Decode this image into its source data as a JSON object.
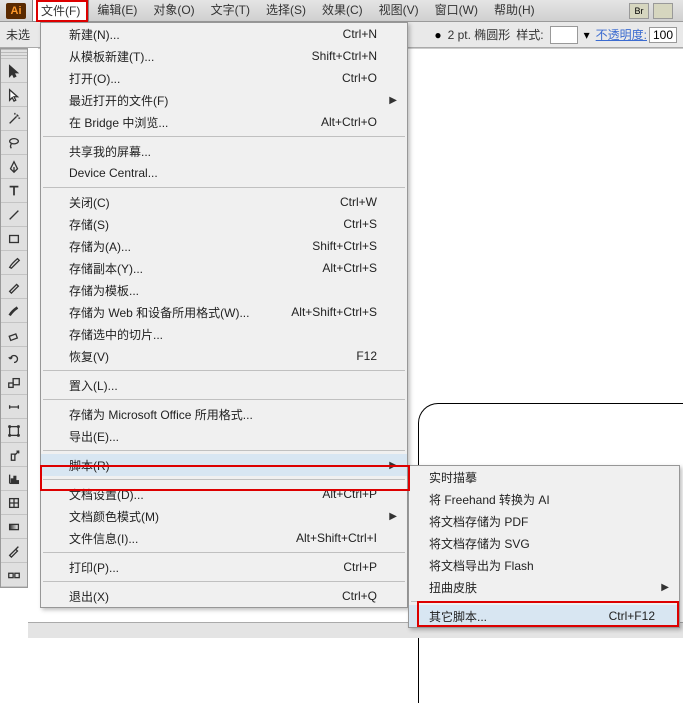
{
  "app": {
    "icon_text": "Ai"
  },
  "menubar": {
    "items": [
      "文件(F)",
      "编辑(E)",
      "对象(O)",
      "文字(T)",
      "选择(S)",
      "效果(C)",
      "视图(V)",
      "窗口(W)",
      "帮助(H)"
    ],
    "right_chips": [
      "Br",
      ""
    ]
  },
  "optbar": {
    "left_label": "未选",
    "stroke_label": "2 pt. 椭圆形",
    "style_label": "样式:",
    "opacity_label": "不透明度:",
    "opacity_value": "100"
  },
  "file_menu": [
    {
      "label": "新建(N)...",
      "shortcut": "Ctrl+N"
    },
    {
      "label": "从模板新建(T)...",
      "shortcut": "Shift+Ctrl+N"
    },
    {
      "label": "打开(O)...",
      "shortcut": "Ctrl+O"
    },
    {
      "label": "最近打开的文件(F)",
      "arrow": true
    },
    {
      "label": "在 Bridge 中浏览...",
      "shortcut": "Alt+Ctrl+O"
    },
    {
      "sep": true
    },
    {
      "label": "共享我的屏幕..."
    },
    {
      "label": "Device Central..."
    },
    {
      "sep": true
    },
    {
      "label": "关闭(C)",
      "shortcut": "Ctrl+W"
    },
    {
      "label": "存储(S)",
      "shortcut": "Ctrl+S"
    },
    {
      "label": "存储为(A)...",
      "shortcut": "Shift+Ctrl+S"
    },
    {
      "label": "存储副本(Y)...",
      "shortcut": "Alt+Ctrl+S"
    },
    {
      "label": "存储为模板..."
    },
    {
      "label": "存储为 Web 和设备所用格式(W)...",
      "shortcut": "Alt+Shift+Ctrl+S"
    },
    {
      "label": "存储选中的切片..."
    },
    {
      "label": "恢复(V)",
      "shortcut": "F12"
    },
    {
      "sep": true
    },
    {
      "label": "置入(L)..."
    },
    {
      "sep": true
    },
    {
      "label": "存储为 Microsoft Office 所用格式..."
    },
    {
      "label": "导出(E)..."
    },
    {
      "sep": true
    },
    {
      "label": "脚本(R)",
      "arrow": true,
      "hover": true
    },
    {
      "sep": true
    },
    {
      "label": "文档设置(D)...",
      "shortcut": "Alt+Ctrl+P"
    },
    {
      "label": "文档颜色模式(M)",
      "arrow": true
    },
    {
      "label": "文件信息(I)...",
      "shortcut": "Alt+Shift+Ctrl+I"
    },
    {
      "sep": true
    },
    {
      "label": "打印(P)...",
      "shortcut": "Ctrl+P"
    },
    {
      "sep": true
    },
    {
      "label": "退出(X)",
      "shortcut": "Ctrl+Q"
    }
  ],
  "script_submenu": [
    {
      "label": "实时描摹"
    },
    {
      "label": "将 Freehand 转换为 AI"
    },
    {
      "label": "将文档存储为 PDF"
    },
    {
      "label": "将文档存储为 SVG"
    },
    {
      "label": "将文档导出为 Flash"
    },
    {
      "label": "扭曲皮肤",
      "arrow": true
    },
    {
      "sep": true
    },
    {
      "label": "其它脚本...",
      "shortcut": "Ctrl+F12",
      "hover": true
    }
  ]
}
